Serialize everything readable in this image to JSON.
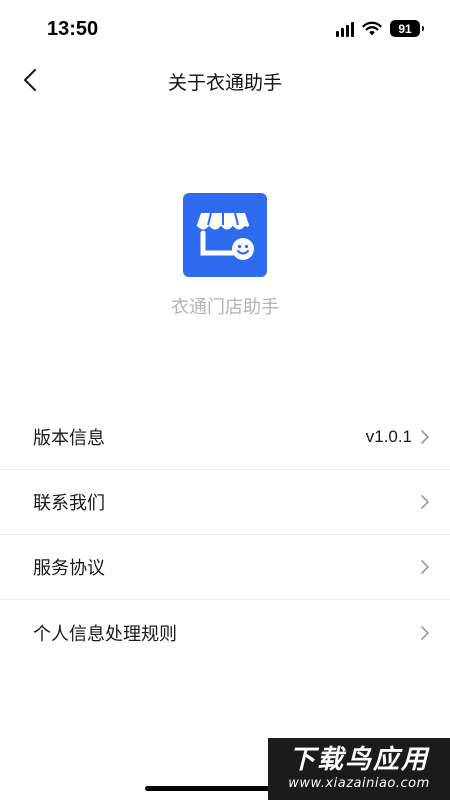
{
  "status_bar": {
    "time": "13:50",
    "battery": "91",
    "icons": [
      "signal-icon",
      "wifi-icon",
      "battery-icon"
    ]
  },
  "nav": {
    "title": "关于衣通助手",
    "back_icon": "chevron-left-icon"
  },
  "app": {
    "name": "衣通门店助手",
    "logo_icon": "store-smile-icon",
    "logo_color": "#2f6bf0"
  },
  "menu": {
    "items": [
      {
        "label": "版本信息",
        "value": "v1.0.1"
      },
      {
        "label": "联系我们",
        "value": ""
      },
      {
        "label": "服务协议",
        "value": ""
      },
      {
        "label": "个人信息处理规则",
        "value": ""
      }
    ]
  },
  "watermark": {
    "title": "下载鸟应用",
    "url": "www.xiazainiao.com"
  }
}
